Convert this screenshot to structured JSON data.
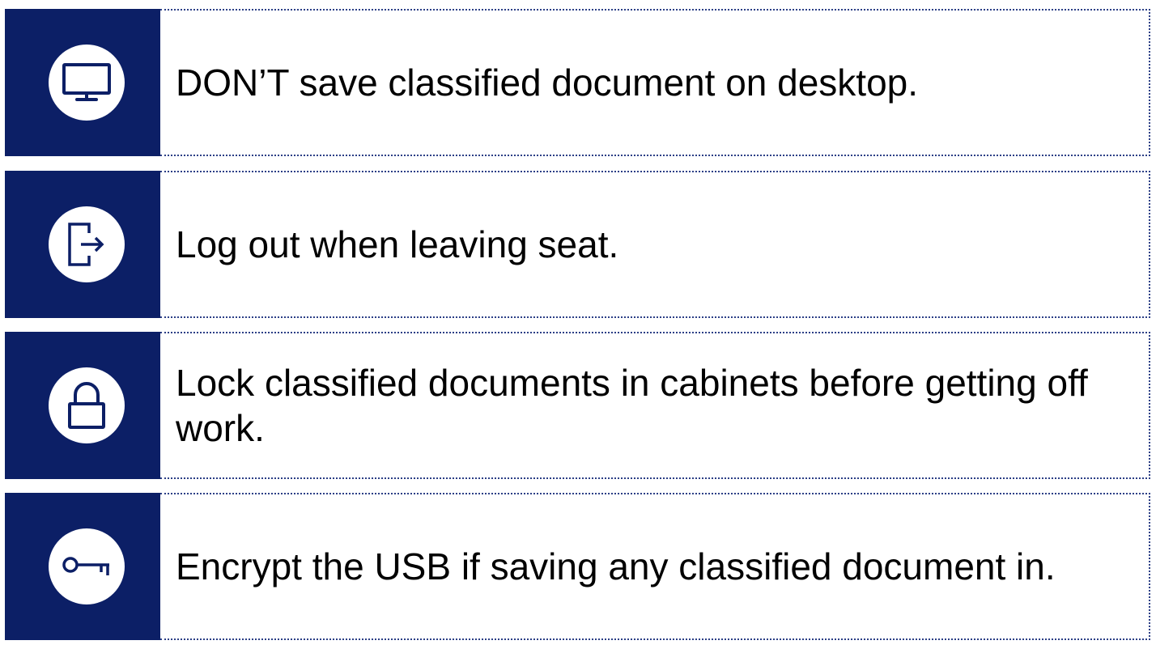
{
  "colors": {
    "navy": "#0c1f66",
    "border": "#2c3f86"
  },
  "rules": [
    {
      "icon": "monitor-icon",
      "text": "DON’T save classified document on desktop."
    },
    {
      "icon": "logout-icon",
      "text": "Log out when leaving seat."
    },
    {
      "icon": "lock-icon",
      "text": "Lock classified documents in cabinets before getting off work."
    },
    {
      "icon": "key-icon",
      "text": "Encrypt the USB if saving any classified document in."
    }
  ]
}
